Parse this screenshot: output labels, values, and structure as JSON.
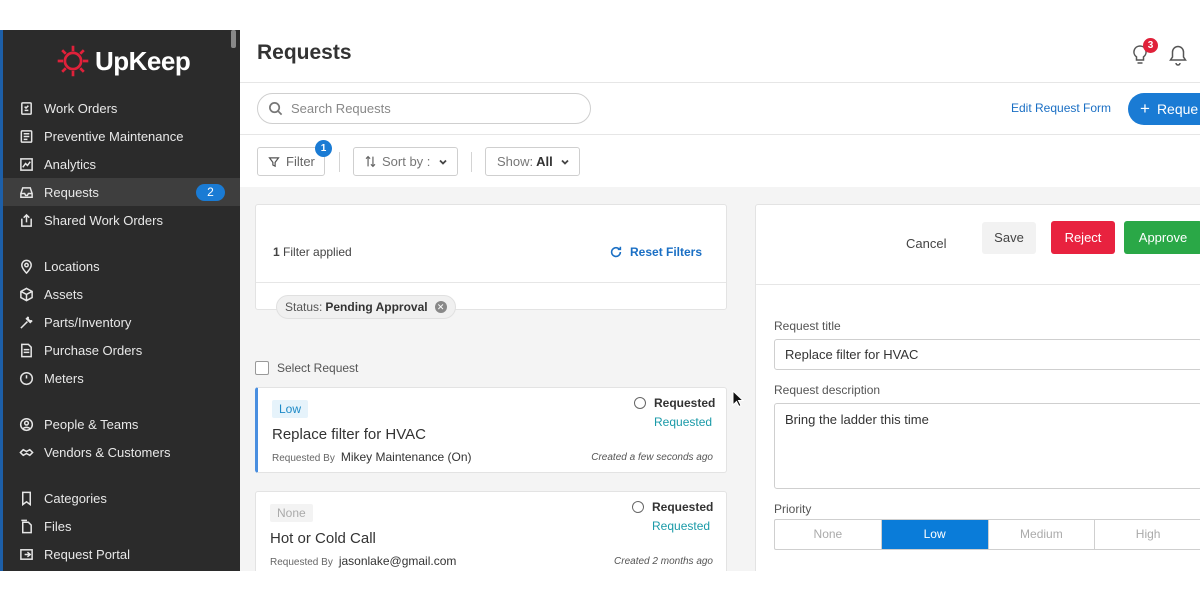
{
  "brand": {
    "name": "UpKeep",
    "accent": "#e0213a"
  },
  "sidebar": {
    "items": [
      {
        "label": "Work Orders",
        "icon": "work-orders-icon"
      },
      {
        "label": "Preventive Maintenance",
        "icon": "calendar-icon"
      },
      {
        "label": "Analytics",
        "icon": "chart-icon"
      },
      {
        "label": "Requests",
        "icon": "inbox-icon",
        "badge": "2",
        "active": true
      },
      {
        "label": "Shared Work Orders",
        "icon": "share-icon"
      },
      {
        "label": "Locations",
        "icon": "location-pin-icon"
      },
      {
        "label": "Assets",
        "icon": "cube-icon"
      },
      {
        "label": "Parts/Inventory",
        "icon": "wrench-icon"
      },
      {
        "label": "Purchase Orders",
        "icon": "document-icon"
      },
      {
        "label": "Meters",
        "icon": "gauge-icon"
      },
      {
        "label": "People & Teams",
        "icon": "people-icon"
      },
      {
        "label": "Vendors & Customers",
        "icon": "vendors-icon"
      },
      {
        "label": "Categories",
        "icon": "bookmark-icon"
      },
      {
        "label": "Files",
        "icon": "files-icon"
      },
      {
        "label": "Request Portal",
        "icon": "portal-icon"
      }
    ]
  },
  "header": {
    "title": "Requests",
    "notification_count": "3"
  },
  "toolbar": {
    "search_placeholder": "Search Requests",
    "edit_form": "Edit Request Form",
    "new_request": "Reque",
    "new_request_plus": "+",
    "filter_label": "Filter",
    "filter_count": "1",
    "sort_label": "Sort by :",
    "show_label": "Show:",
    "show_value": "All"
  },
  "filters": {
    "count": "1",
    "applied_text": "Filter applied",
    "reset": "Reset Filters",
    "chip_key": "Status:",
    "chip_value": "Pending Approval",
    "select_label": "Select Request"
  },
  "requests": [
    {
      "priority": "Low",
      "title": "Replace filter for HVAC",
      "by_label": "Requested By",
      "by": "Mikey Maintenance (On)",
      "status": "Requested",
      "status_sub": "Requested",
      "created": "Created a few seconds ago"
    },
    {
      "priority": "None",
      "title": "Hot or Cold Call",
      "by_label": "Requested By",
      "by": "jasonlake@gmail.com",
      "status": "Requested",
      "status_sub": "Requested",
      "created": "Created 2 months ago"
    }
  ],
  "detail": {
    "cancel": "Cancel",
    "save": "Save",
    "reject": "Reject",
    "approve": "Approve",
    "title_label": "Request title",
    "title_value": "Replace filter for HVAC",
    "desc_label": "Request description",
    "desc_value": "Bring the ladder this time",
    "priority_label": "Priority",
    "priority_options": [
      "None",
      "Low",
      "Medium",
      "High"
    ],
    "priority_selected": "Low"
  }
}
